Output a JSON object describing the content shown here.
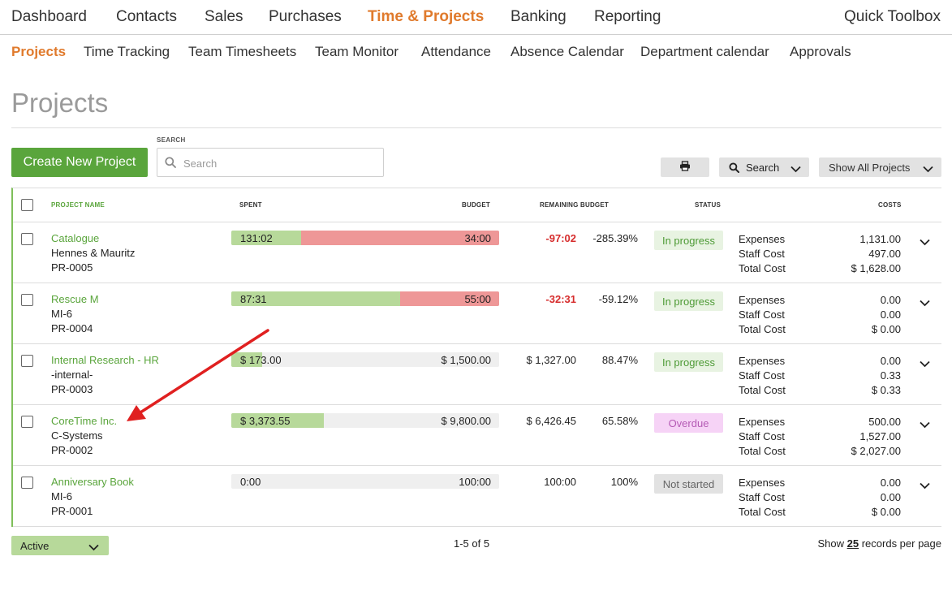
{
  "topnav": {
    "items": [
      "Dashboard",
      "Contacts",
      "Sales",
      "Purchases",
      "Time & Projects",
      "Banking",
      "Reporting"
    ],
    "quick_toolbox": "Quick Toolbox"
  },
  "subnav": {
    "items": [
      "Projects",
      "Time Tracking",
      "Team Timesheets",
      "Team Monitor",
      "Attendance",
      "Absence Calendar",
      "Department calendar",
      "Approvals"
    ]
  },
  "page": {
    "title": "Projects"
  },
  "toolbar": {
    "create_label": "Create New Project",
    "search_label": "SEARCH",
    "search_placeholder": "Search",
    "search_dropdown_label": "Search",
    "show_all_label": "Show All Projects"
  },
  "table": {
    "headers": {
      "project_name": "PROJECT NAME",
      "spent": "SPENT",
      "budget": "BUDGET",
      "remaining": "REMAINING BUDGET",
      "status": "STATUS",
      "costs": "COSTS"
    },
    "cost_labels": {
      "expenses": "Expenses",
      "staff": "Staff Cost",
      "total": "Total Cost"
    },
    "rows": [
      {
        "name": "Catalogue",
        "client": "Hennes & Mauritz",
        "code": "PR-0005",
        "spent": "131:02",
        "budget": "34:00",
        "spent_fraction": 0.26,
        "over_budget": true,
        "remaining": "-97:02",
        "remaining_negative": true,
        "percent": "-285.39%",
        "status": "In progress",
        "status_kind": "progress",
        "expenses": "1,131.00",
        "staff_cost": "497.00",
        "total_cost": "$ 1,628.00"
      },
      {
        "name": "Rescue M",
        "client": "MI-6",
        "code": "PR-0004",
        "spent": "87:31",
        "budget": "55:00",
        "spent_fraction": 0.63,
        "over_budget": true,
        "remaining": "-32:31",
        "remaining_negative": true,
        "percent": "-59.12%",
        "status": "In progress",
        "status_kind": "progress",
        "expenses": "0.00",
        "staff_cost": "0.00",
        "total_cost": "$ 0.00"
      },
      {
        "name": "Internal Research - HR",
        "client": "-internal-",
        "code": "PR-0003",
        "spent": "$ 173.00",
        "budget": "$ 1,500.00",
        "spent_fraction": 0.1153,
        "over_budget": false,
        "remaining": "$ 1,327.00",
        "remaining_negative": false,
        "percent": "88.47%",
        "status": "In progress",
        "status_kind": "progress",
        "expenses": "0.00",
        "staff_cost": "0.33",
        "total_cost": "$ 0.33"
      },
      {
        "name": "CoreTime Inc.",
        "client": "C-Systems",
        "code": "PR-0002",
        "spent": "$ 3,373.55",
        "budget": "$ 9,800.00",
        "spent_fraction": 0.3442,
        "over_budget": false,
        "remaining": "$ 6,426.45",
        "remaining_negative": false,
        "percent": "65.58%",
        "status": "Overdue",
        "status_kind": "overdue",
        "expenses": "500.00",
        "staff_cost": "1,527.00",
        "total_cost": "$ 2,027.00"
      },
      {
        "name": "Anniversary Book",
        "client": "MI-6",
        "code": "PR-0001",
        "spent": "0:00",
        "budget": "100:00",
        "spent_fraction": 0,
        "over_budget": false,
        "remaining": "100:00",
        "remaining_negative": false,
        "percent": "100%",
        "status": "Not started",
        "status_kind": "notstarted",
        "expenses": "0.00",
        "staff_cost": "0.00",
        "total_cost": "$ 0.00"
      }
    ]
  },
  "footer": {
    "filter_value": "Active",
    "pagination": "1-5 of 5",
    "per_page_prefix": "Show",
    "per_page_count": "25",
    "per_page_suffix": "records per page"
  },
  "colors": {
    "accent_orange": "#e07a2c",
    "brand_green": "#5aa53c",
    "bar_green": "#b7d99a",
    "bar_red": "#ee9797",
    "negative_red": "#d62c2c",
    "annotation_arrow": "#e02020"
  },
  "icons": [
    "search-icon",
    "printer-icon",
    "chevron-down-icon"
  ]
}
